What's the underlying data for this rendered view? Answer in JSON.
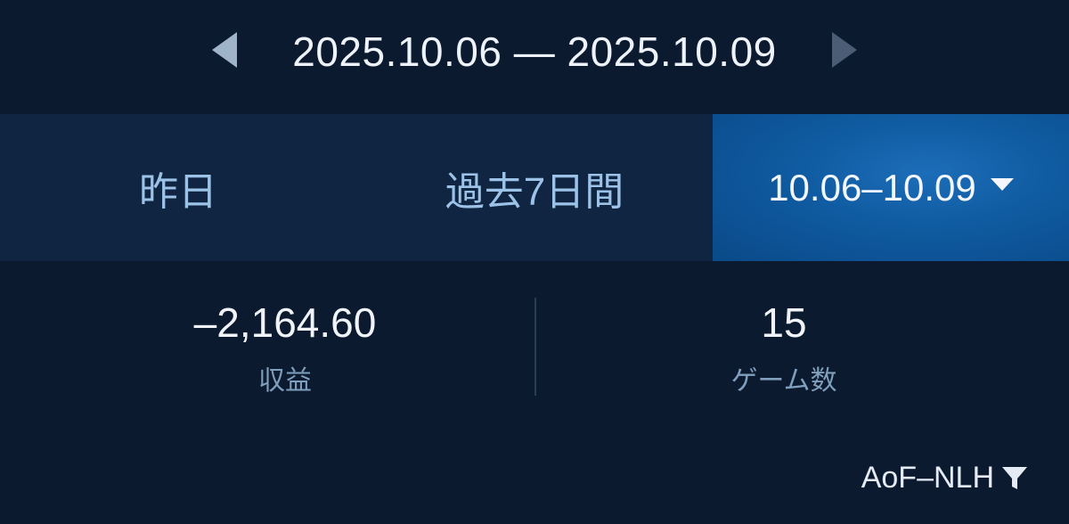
{
  "header": {
    "date_range": "2025.10.06 — 2025.10.09",
    "prev_icon": "triangle-left-icon",
    "next_icon": "triangle-right-icon"
  },
  "tabs": [
    {
      "label": "昨日",
      "active": false
    },
    {
      "label": "過去7日間",
      "active": false
    },
    {
      "label": "10.06–10.09",
      "active": true,
      "icon": "caret-down-icon"
    }
  ],
  "stats": {
    "profit": {
      "value": "–2,164.60",
      "label": "収益"
    },
    "games": {
      "value": "15",
      "label": "ゲーム数"
    }
  },
  "filter": {
    "label": "AoF–NLH",
    "icon": "funnel-icon"
  },
  "colors": {
    "background": "#0b1a2e",
    "tab_bar": "#0f2541",
    "active_tab": "#1c6db8",
    "inactive_tab_text": "#9cc2e8",
    "label_text": "#7f9fbd"
  }
}
